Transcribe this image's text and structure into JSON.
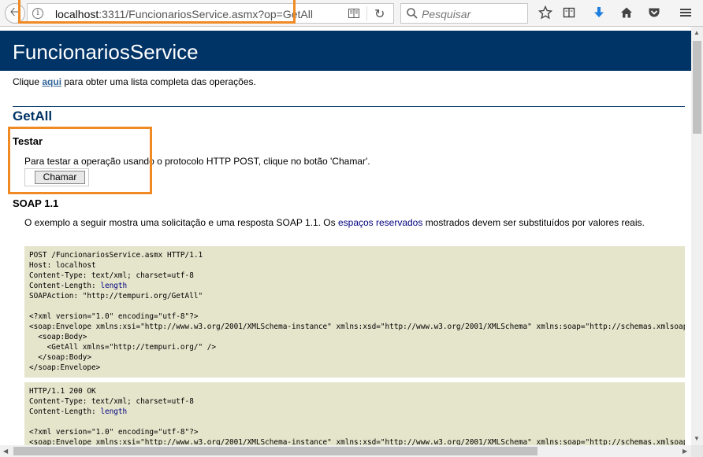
{
  "browser": {
    "url_host": "localhost",
    "url_rest": ":3311/FuncionariosService.asmx?op=GetAll",
    "search_placeholder": "Pesquisar",
    "highlight_color": "#f08a24"
  },
  "page": {
    "title": "FuncionariosService",
    "intro_before": "Clique ",
    "intro_link": "aqui",
    "intro_after": " para obter uma lista completa das operações.",
    "operation": "GetAll",
    "test": {
      "heading": "Testar",
      "text": "Para testar a operação usando o protocolo HTTP POST, clique no botão 'Chamar'.",
      "button_label": "Chamar"
    },
    "soap": {
      "heading": "SOAP 1.1",
      "desc_before": "O exemplo a seguir mostra uma solicitação e uma resposta SOAP 1.1. Os ",
      "desc_placeholder": "espaços reservados",
      "desc_after": " mostrados devem ser substituídos por valores reais.",
      "request": {
        "line1": "POST /FuncionariosService.asmx HTTP/1.1",
        "line2": "Host: localhost",
        "line3": "Content-Type: text/xml; charset=utf-8",
        "line4_before": "Content-Length: ",
        "line4_placeholder": "length",
        "line5": "SOAPAction: \"http://tempuri.org/GetAll\"",
        "line6": "<?xml version=\"1.0\" encoding=\"utf-8\"?>",
        "line7": "<soap:Envelope xmlns:xsi=\"http://www.w3.org/2001/XMLSchema-instance\" xmlns:xsd=\"http://www.w3.org/2001/XMLSchema\" xmlns:soap=\"http://schemas.xmlsoap.org/soap/envelope/\">",
        "line8": "  <soap:Body>",
        "line9": "    <GetAll xmlns=\"http://tempuri.org/\" />",
        "line10": "  </soap:Body>",
        "line11": "</soap:Envelope>"
      },
      "response": {
        "line1": "HTTP/1.1 200 OK",
        "line2": "Content-Type: text/xml; charset=utf-8",
        "line3_before": "Content-Length: ",
        "line3_placeholder": "length",
        "line4": "<?xml version=\"1.0\" encoding=\"utf-8\"?>",
        "line5": "<soap:Envelope xmlns:xsi=\"http://www.w3.org/2001/XMLSchema-instance\" xmlns:xsd=\"http://www.w3.org/2001/XMLSchema\" xmlns:soap=\"http://schemas.xmlsoap.org/soap/envelope/\">"
      }
    }
  },
  "colors": {
    "header_bg": "#003366",
    "code_bg": "#e5e5cc",
    "link": "#336699",
    "placeholder": "#000080"
  },
  "icons": {
    "back": "back-arrow-icon",
    "info": "info-icon",
    "reader": "reader-view-icon",
    "reload": "reload-icon",
    "search": "search-icon",
    "bookmark": "star-icon",
    "library": "reading-list-icon",
    "download": "download-icon",
    "home": "home-icon",
    "pocket": "pocket-icon",
    "menu": "menu-icon"
  }
}
